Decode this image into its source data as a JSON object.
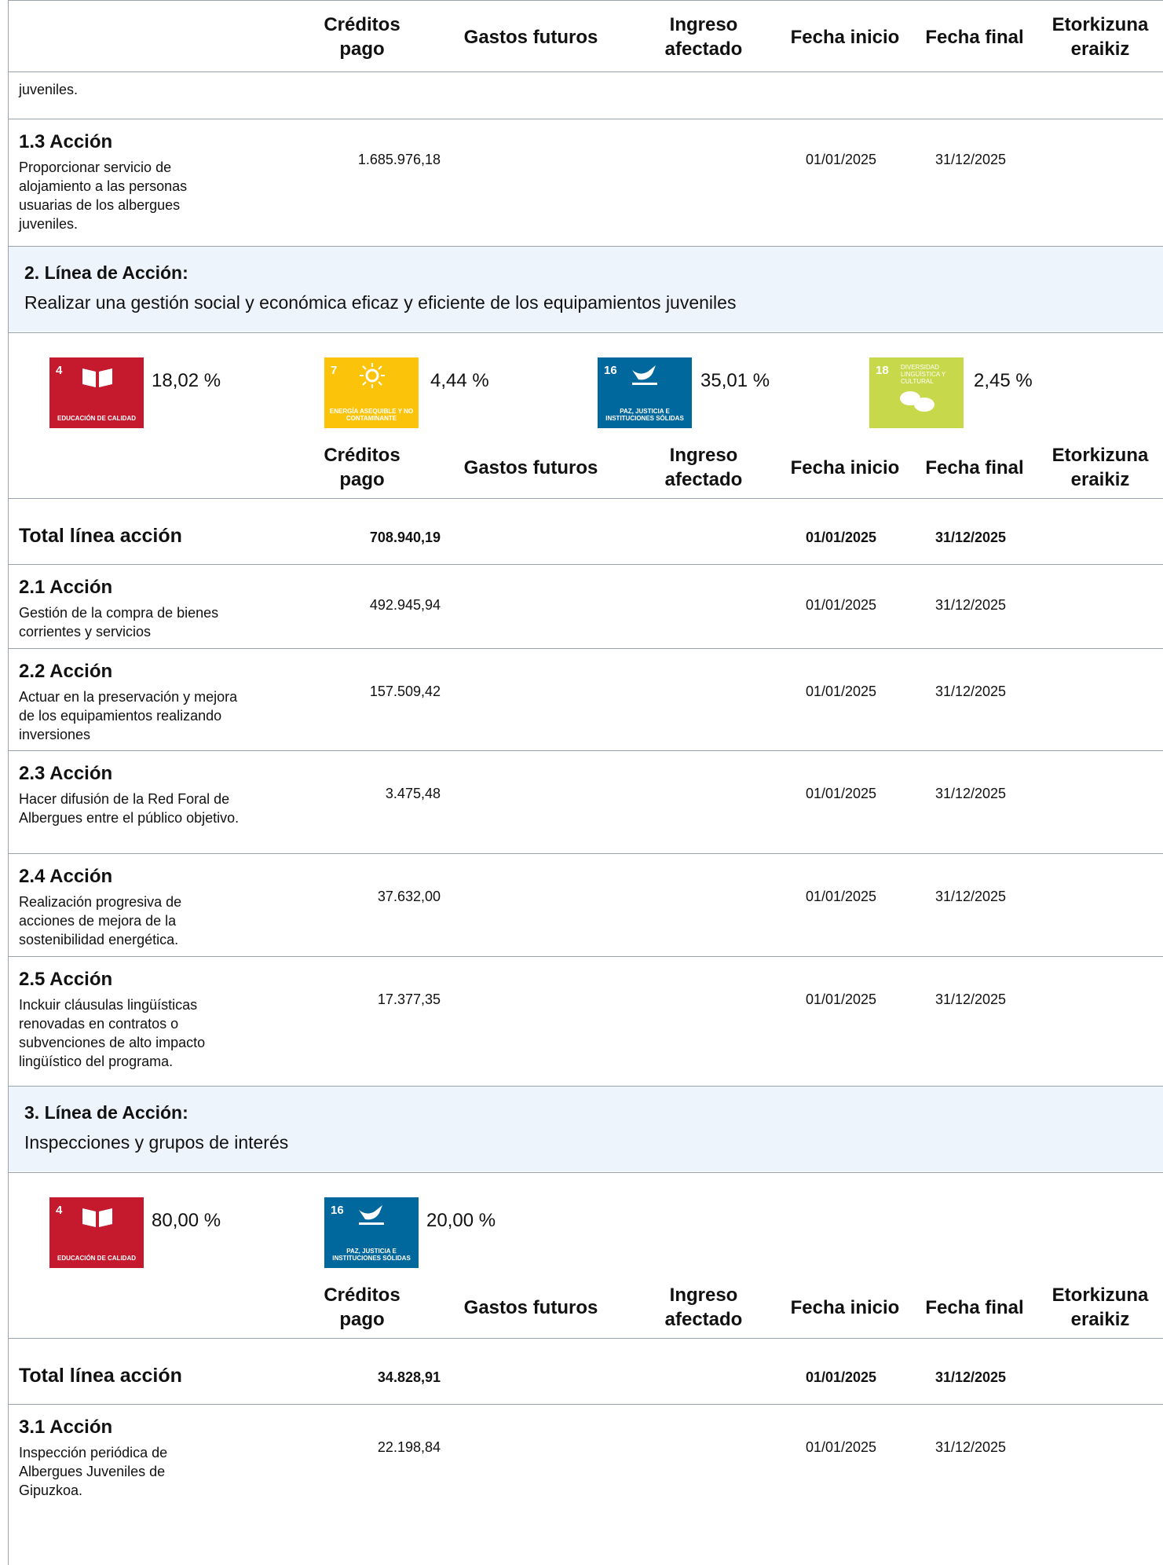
{
  "headers": {
    "creditos": "Créditos pago",
    "gastos": "Gastos futuros",
    "ingreso": "Ingreso afectado",
    "inicio": "Fecha inicio",
    "final": "Fecha final",
    "etork": "Etorkizuna eraikiz"
  },
  "carry_text": "juveniles.",
  "a13": {
    "title": "1.3 Acción",
    "desc": "Proporcionar servicio de alojamiento a las personas usuarias de los albergues juveniles.",
    "amount": "1.685.976,18",
    "start": "01/01/2025",
    "end": "31/12/2025"
  },
  "line2": {
    "label": "2. Línea de Acción:",
    "text": "Realizar una gestión social y económica eficaz y eficiente de los equipamientos juveniles",
    "ods": [
      {
        "num": "4",
        "caption": "EDUCACIÓN DE CALIDAD",
        "pct": "18,02 %",
        "color": "#c5192d"
      },
      {
        "num": "7",
        "caption": "ENERGÍA ASEQUIBLE Y NO CONTAMINANTE",
        "pct": "4,44 %",
        "color": "#fcc30b"
      },
      {
        "num": "16",
        "caption": "PAZ, JUSTICIA E INSTITUCIONES SÓLIDAS",
        "pct": "35,01 %",
        "color": "#00689d"
      },
      {
        "num": "18",
        "caption": "DIVERSIDAD LINGÜÍSTICA Y CULTURAL",
        "pct": "2,45 %",
        "color": "#c7d84b"
      }
    ],
    "total": {
      "label": "Total línea acción",
      "amount": "708.940,19",
      "start": "01/01/2025",
      "end": "31/12/2025"
    },
    "actions": [
      {
        "title": "2.1 Acción",
        "desc": "Gestión de la compra de bienes corrientes y servicios",
        "amount": "492.945,94",
        "start": "01/01/2025",
        "end": "31/12/2025"
      },
      {
        "title": "2.2 Acción",
        "desc": "Actuar en la preservación y mejora de los equipamientos realizando inversiones",
        "amount": "157.509,42",
        "start": "01/01/2025",
        "end": "31/12/2025"
      },
      {
        "title": "2.3 Acción",
        "desc": "Hacer difusión de la Red Foral de Albergues entre el público objetivo.",
        "amount": "3.475,48",
        "start": "01/01/2025",
        "end": "31/12/2025"
      },
      {
        "title": "2.4 Acción",
        "desc": "Realización progresiva de acciones de mejora de la sostenibilidad energética.",
        "amount": "37.632,00",
        "start": "01/01/2025",
        "end": "31/12/2025"
      },
      {
        "title": "2.5 Acción",
        "desc": "Inckuir cláusulas lingüísticas renovadas en contratos o subvenciones de alto impacto lingüístico del programa.",
        "amount": "17.377,35",
        "start": "01/01/2025",
        "end": "31/12/2025"
      }
    ]
  },
  "line3": {
    "label": "3. Línea de Acción:",
    "text": "Inspecciones y grupos de interés",
    "ods": [
      {
        "num": "4",
        "caption": "EDUCACIÓN DE CALIDAD",
        "pct": "80,00 %",
        "color": "#c5192d"
      },
      {
        "num": "16",
        "caption": "PAZ, JUSTICIA E INSTITUCIONES SÓLIDAS",
        "pct": "20,00 %",
        "color": "#00689d"
      }
    ],
    "total": {
      "label": "Total línea acción",
      "amount": "34.828,91",
      "start": "01/01/2025",
      "end": "31/12/2025"
    },
    "actions": [
      {
        "title": "3.1 Acción",
        "desc": "Inspección periódica de Albergues Juveniles de Gipuzkoa.",
        "amount": "22.198,84",
        "start": "01/01/2025",
        "end": "31/12/2025"
      }
    ]
  }
}
